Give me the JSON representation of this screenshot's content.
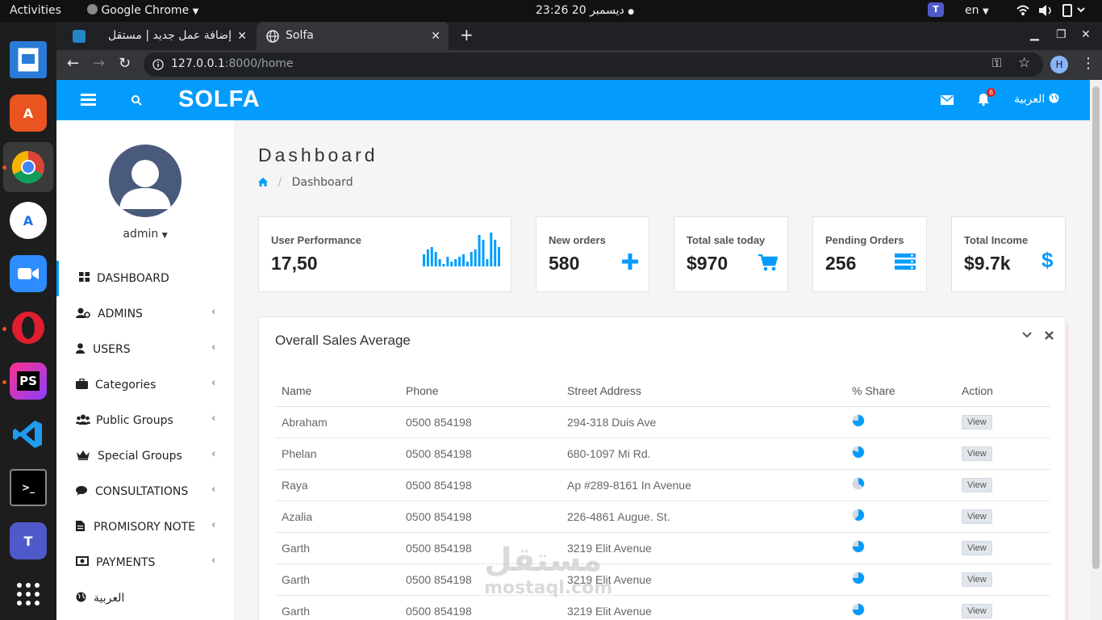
{
  "system": {
    "activities": "Activities",
    "app_menu": "Google Chrome",
    "clock": "23:26  20 ديسمبر",
    "lang": "en"
  },
  "browser": {
    "tabs": [
      {
        "title": "إضافة عمل جديد | مستقل"
      },
      {
        "title": "Solfa"
      }
    ],
    "url_host": "127.0.0.1",
    "url_rest": ":8000/home",
    "profile_initial": "H"
  },
  "header": {
    "brand": "SOLFA",
    "notification_count": "6",
    "language_link": "العربية"
  },
  "sidebar": {
    "username": "admin",
    "items": [
      {
        "label": "DASHBOARD",
        "icon": "dashboard-icon",
        "arrow": false
      },
      {
        "label": "ADMINS",
        "icon": "admins-icon",
        "arrow": true
      },
      {
        "label": "USERS",
        "icon": "user-icon",
        "arrow": true
      },
      {
        "label": "Categories",
        "icon": "briefcase-icon",
        "arrow": true
      },
      {
        "label": "Public Groups",
        "icon": "users-icon",
        "arrow": true
      },
      {
        "label": "Special Groups",
        "icon": "crown-icon",
        "arrow": true
      },
      {
        "label": "CONSULTATIONS",
        "icon": "comments-icon",
        "arrow": true
      },
      {
        "label": "PROMISORY NOTE",
        "icon": "file-icon",
        "arrow": true
      },
      {
        "label": "PAYMENTS",
        "icon": "money-icon",
        "arrow": true
      },
      {
        "label": "العربية",
        "icon": "globe-icon",
        "arrow": false
      }
    ]
  },
  "page": {
    "title": "Dashboard",
    "breadcrumb": "Dashboard"
  },
  "stats": [
    {
      "label": "User Performance",
      "value": "17,50",
      "icon": "sparkline"
    },
    {
      "label": "New orders",
      "value": "580",
      "icon": "plus-icon"
    },
    {
      "label": "Total sale today",
      "value": "$970",
      "icon": "cart-icon"
    },
    {
      "label": "Pending Orders",
      "value": "256",
      "icon": "server-icon"
    },
    {
      "label": "Total Income",
      "value": "$9.7k",
      "icon": "dollar-icon"
    }
  ],
  "sparkline_values": [
    5,
    7,
    8,
    6,
    3,
    1,
    4,
    2,
    3,
    4,
    5,
    2,
    6,
    7,
    13,
    11,
    3,
    14,
    11,
    8
  ],
  "colors": {
    "accent": "#039cfd"
  },
  "sales_panel": {
    "title": "Overall Sales Average",
    "columns": [
      "Name",
      "Phone",
      "Street Address",
      "% Share",
      "Action"
    ],
    "rows": [
      {
        "name": "Abraham",
        "phone": "0500 854198",
        "address": "294-318 Duis Ave",
        "share": 0.75,
        "action": "View"
      },
      {
        "name": "Phelan",
        "phone": "0500 854198",
        "address": "680-1097 Mi Rd.",
        "share": 0.8,
        "action": "View"
      },
      {
        "name": "Raya",
        "phone": "0500 854198",
        "address": "Ap #289-8161 In Avenue",
        "share": 0.35,
        "action": "View"
      },
      {
        "name": "Azalia",
        "phone": "0500 854198",
        "address": "226-4861 Augue. St.",
        "share": 0.6,
        "action": "View"
      },
      {
        "name": "Garth",
        "phone": "0500 854198",
        "address": "3219 Elit Avenue",
        "share": 0.75,
        "action": "View"
      },
      {
        "name": "Garth",
        "phone": "0500 854198",
        "address": "3219 Elit Avenue",
        "share": 0.75,
        "action": "View"
      },
      {
        "name": "Garth",
        "phone": "0500 854198",
        "address": "3219 Elit Avenue",
        "share": 0.75,
        "action": "View"
      }
    ]
  },
  "watermark": {
    "arabic": "مستقل",
    "latin": "mostaql.com"
  }
}
